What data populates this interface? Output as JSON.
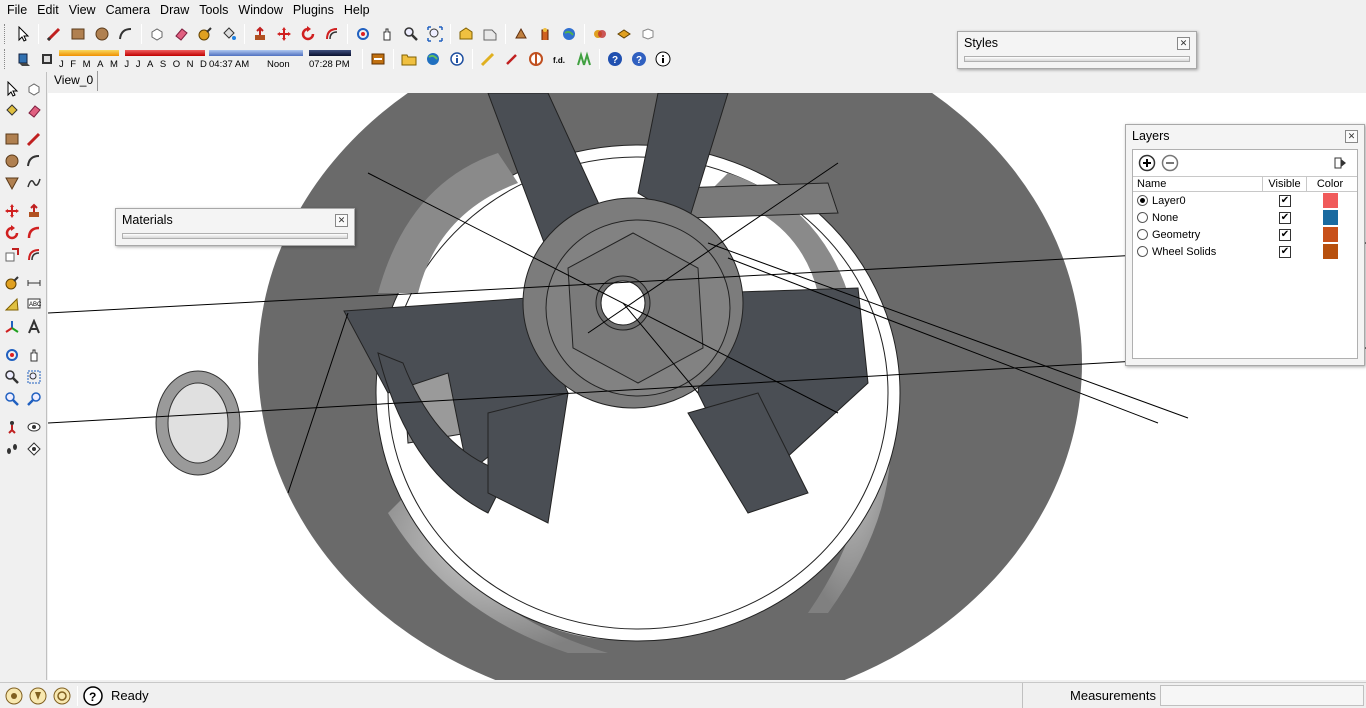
{
  "menu": [
    "File",
    "Edit",
    "View",
    "Camera",
    "Draw",
    "Tools",
    "Window",
    "Plugins",
    "Help"
  ],
  "shadow": {
    "months": [
      "J",
      "F",
      "M",
      "A",
      "M",
      "J",
      "J",
      "A",
      "S",
      "O",
      "N",
      "D"
    ],
    "time_start": "04:37 AM",
    "time_noon": "Noon",
    "time_end": "07:28 PM"
  },
  "scene_tab": "View_0",
  "status": {
    "text": "Ready",
    "measurements_label": "Measurements",
    "measurements_value": ""
  },
  "styles_panel": {
    "title": "Styles"
  },
  "materials_panel": {
    "title": "Materials"
  },
  "layers_panel": {
    "title": "Layers",
    "columns": {
      "name": "Name",
      "visible": "Visible",
      "color": "Color"
    },
    "rows": [
      {
        "name": "Layer0",
        "active": true,
        "visible": true,
        "color": "#f05a5a"
      },
      {
        "name": "None",
        "active": false,
        "visible": true,
        "color": "#1a6aa0"
      },
      {
        "name": "Geometry",
        "active": false,
        "visible": true,
        "color": "#c8501a"
      },
      {
        "name": "Wheel Solids",
        "active": false,
        "visible": true,
        "color": "#b8500e"
      }
    ]
  }
}
